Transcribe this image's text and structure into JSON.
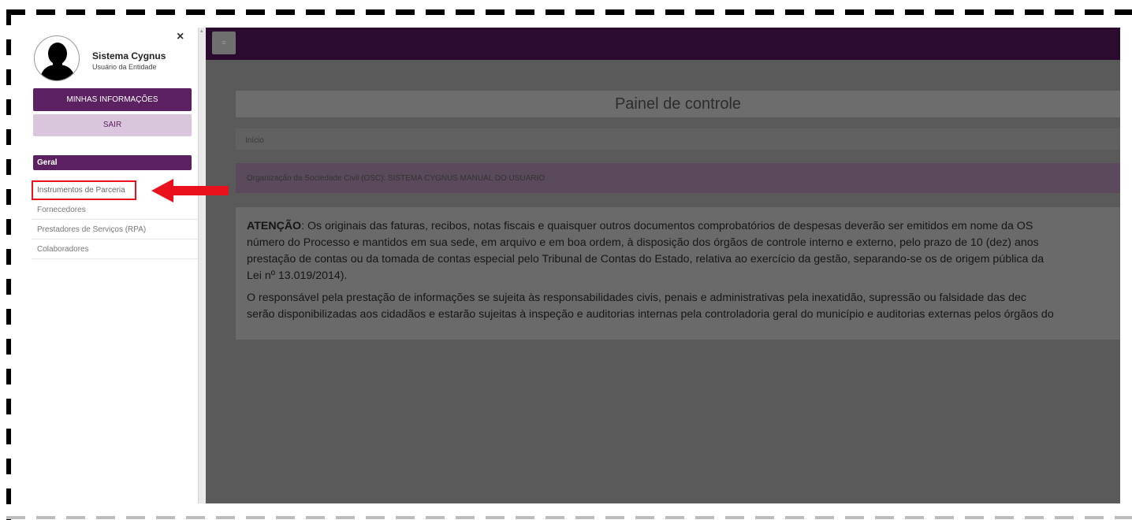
{
  "sidebar": {
    "user_name": "Sistema Cygnus",
    "user_role": "Usuário da Entidade",
    "my_info_label": "MINHAS INFORMAÇÕES",
    "logout_label": "SAIR",
    "section_label": "Geral",
    "items": [
      {
        "label": "Instrumentos de Parceria"
      },
      {
        "label": "Fornecedores"
      },
      {
        "label": "Prestadores de Serviços (RPA)"
      },
      {
        "label": "Colaboradores"
      }
    ],
    "close_glyph": "×"
  },
  "header": {
    "menu_glyph": "≡"
  },
  "main": {
    "title": "Painel de controle",
    "breadcrumb": "Início",
    "osc": "Organização da Sociedade Civil (OSC): SISTEMA CYGNUS MANUAL DO USUARIO",
    "notice_bold": "ATENÇÃO",
    "notice_p1_line1": ": Os originais das faturas, recibos, notas fiscais e quaisquer outros documentos comprobatórios de despesas deverão ser emitidos em nome da OS",
    "notice_p1_line2": "número do Processo e mantidos em sua sede, em arquivo e em boa ordem, à disposição dos órgãos de controle interno e externo, pelo prazo de 10 (dez) anos",
    "notice_p1_line3": "prestação de contas ou da tomada de contas especial pelo Tribunal de Contas do Estado, relativa ao exercício da gestão, separando-se os de origem pública da",
    "notice_p1_line4": "Lei nº 13.019/2014).",
    "notice_p2_line1": "O responsável pela prestação de informações se sujeita às responsabilidades civis, penais e administrativas pela inexatidão, supressão ou falsidade das dec",
    "notice_p2_line2": "serão disponibilizadas aos cidadãos e estarão sujeitas à inspeção e auditorias internas pela controladoria geral do município e auditorias externas pelos órgãos do"
  },
  "colors": {
    "brand": "#5c2160",
    "brand_light": "#d9c6dc",
    "topbar": "#2b0b2d",
    "annotation": "#e8111c"
  }
}
